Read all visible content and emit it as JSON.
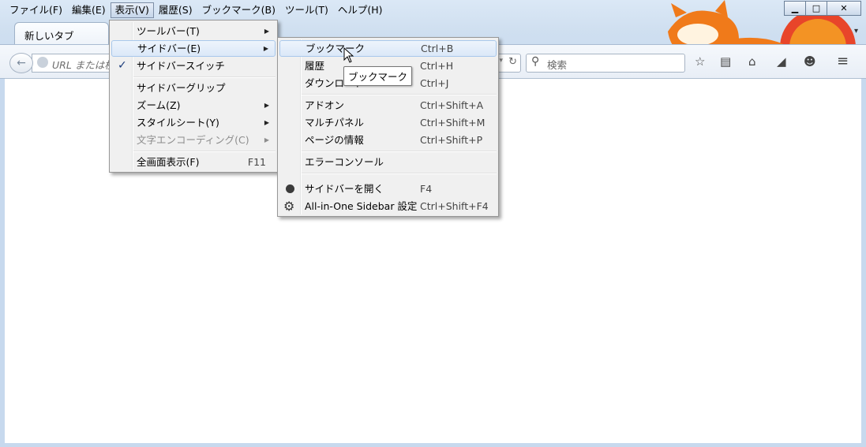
{
  "menubar": {
    "items": [
      {
        "label": "ファイル(F)"
      },
      {
        "label": "編集(E)"
      },
      {
        "label": "表示(V)"
      },
      {
        "label": "履歴(S)"
      },
      {
        "label": "ブックマーク(B)"
      },
      {
        "label": "ツール(T)"
      },
      {
        "label": "ヘルプ(H)"
      }
    ]
  },
  "window_controls": {
    "minimize": "▁",
    "maximize": "□",
    "close": "✕"
  },
  "tab": {
    "title": "新しいタブ",
    "dropdown": "▾"
  },
  "toolbar": {
    "back": "←",
    "url_placeholder": "URL または検",
    "reload": "↻",
    "url_dropdown": "▾",
    "search_placeholder": "検索",
    "search_icon": "magnifier-icon",
    "icons": [
      "star-icon",
      "reading-list-icon",
      "home-icon",
      "send-icon",
      "smiley-icon",
      "hamburger-menu-icon"
    ]
  },
  "view_menu": {
    "items": [
      {
        "label": "ツールバー(T)",
        "submenu": true
      },
      {
        "label": "サイドバー(E)",
        "submenu": true,
        "highlighted": true
      },
      {
        "label": "サイドバースイッチ",
        "checked": true
      },
      {
        "label": "サイドバーグリップ"
      },
      {
        "label": "ズーム(Z)",
        "submenu": true
      },
      {
        "label": "スタイルシート(Y)",
        "submenu": true
      },
      {
        "label": "文字エンコーディング(C)",
        "submenu": true,
        "disabled": true
      },
      {
        "label": "全画面表示(F)",
        "shortcut": "F11"
      }
    ]
  },
  "sidebar_submenu": {
    "items": [
      {
        "label": "ブックマーク",
        "shortcut": "Ctrl+B",
        "highlighted": true
      },
      {
        "label": "履歴",
        "shortcut": "Ctrl+H"
      },
      {
        "label": "ダウンロード",
        "shortcut": "Ctrl+J"
      },
      {
        "label": "アドオン",
        "shortcut": "Ctrl+Shift+A"
      },
      {
        "label": "マルチパネル",
        "shortcut": "Ctrl+Shift+M"
      },
      {
        "label": "ページの情報",
        "shortcut": "Ctrl+Shift+P"
      },
      {
        "label": "エラーコンソール",
        "shortcut": ""
      },
      {
        "label": "サイドバーを開く",
        "shortcut": "F4",
        "icon": "radio-dot-icon"
      },
      {
        "label": "All-in-One Sidebar 設定",
        "shortcut": "Ctrl+Shift+F4",
        "icon": "gear-icon"
      }
    ]
  },
  "tooltip": {
    "text": "ブックマーク"
  }
}
